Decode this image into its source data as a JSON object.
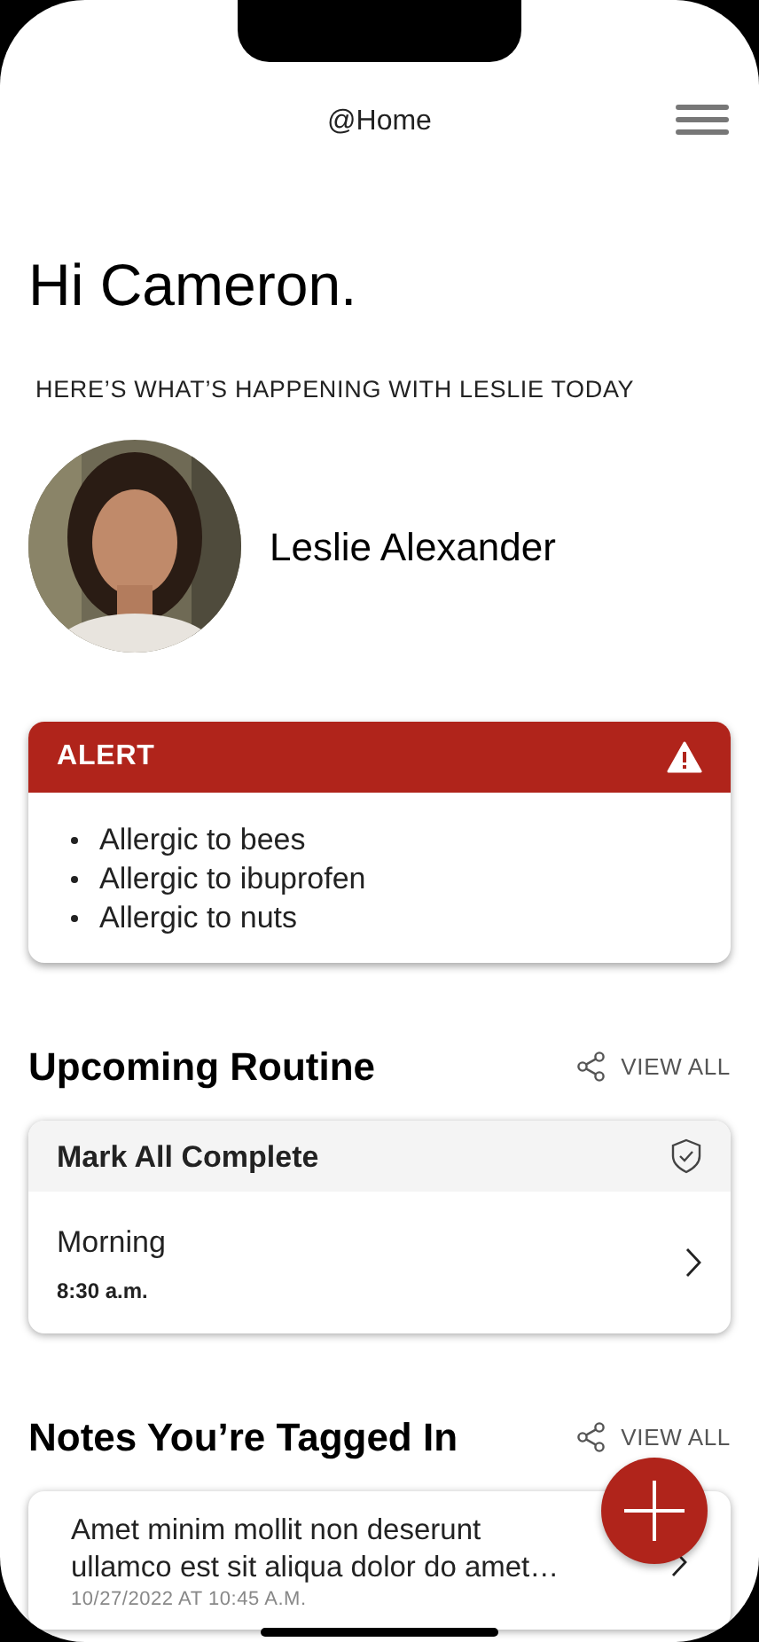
{
  "header": {
    "title": "@Home"
  },
  "greeting": "Hi Cameron.",
  "subtitle": "HERE’S WHAT’S HAPPENING WITH LESLIE TODAY",
  "profile": {
    "name": "Leslie Alexander"
  },
  "alert": {
    "title": "ALERT",
    "items": [
      "Allergic to bees",
      "Allergic to ibuprofen",
      "Allergic to nuts"
    ]
  },
  "routine": {
    "heading": "Upcoming Routine",
    "view_all": "VIEW ALL",
    "mark_all": "Mark All Complete",
    "items": [
      {
        "name": "Morning",
        "time": "8:30 a.m."
      }
    ]
  },
  "notes": {
    "heading": "Notes You’re Tagged In",
    "view_all": "VIEW ALL",
    "items": [
      {
        "text": "Amet minim mollit non deserunt ullamco est sit aliqua dolor do amet…",
        "date": "10/27/2022 AT 10:45 A.M."
      }
    ]
  }
}
